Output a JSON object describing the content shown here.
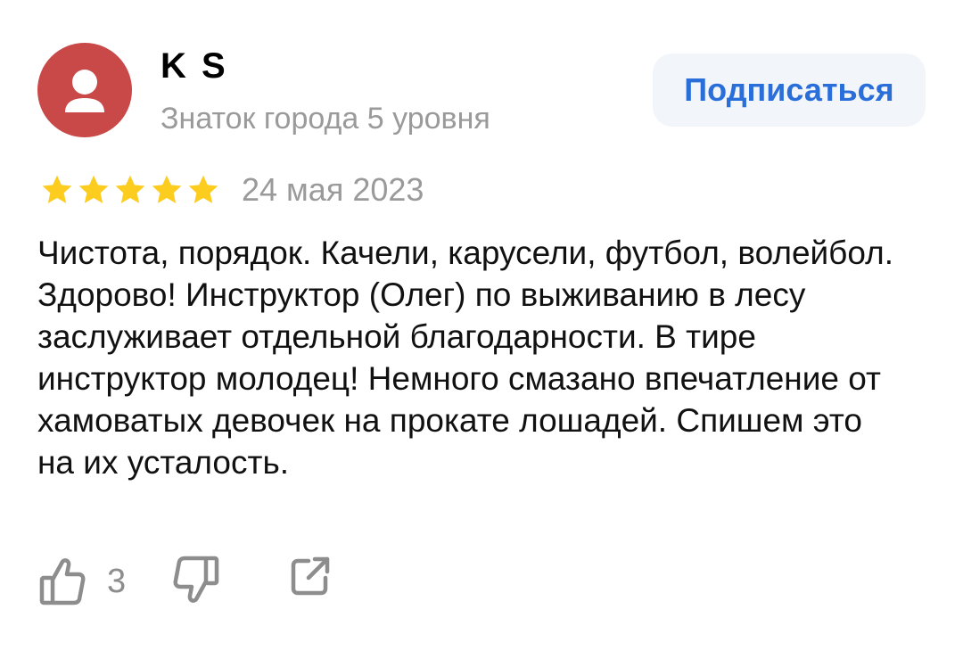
{
  "author": {
    "name": "K S",
    "level": "Знаток города 5 уровня",
    "avatar_icon": "user-icon",
    "avatar_color": "#c94848"
  },
  "subscribe": {
    "label": "Подписаться",
    "color": "#2a6fd9",
    "background": "#f2f5fa"
  },
  "review": {
    "rating": 5,
    "rating_max": 5,
    "star_color": "#fccc1f",
    "date": "24 мая 2023",
    "text": "Чистота, порядок. Качели, карусели, футбол, волейбол. Здорово! Инструктор (Олег) по выживанию в лесу заслуживает отдельной благодарности. В тире инструктор молодец! Немного смазано впечатление от хамоватых девочек на прокате лошадей. Спишем это на их усталость."
  },
  "actions": {
    "like_icon": "thumbs-up-icon",
    "like_count": "3",
    "dislike_icon": "thumbs-down-icon",
    "share_icon": "share-icon",
    "icon_color": "#8d8d8d"
  }
}
